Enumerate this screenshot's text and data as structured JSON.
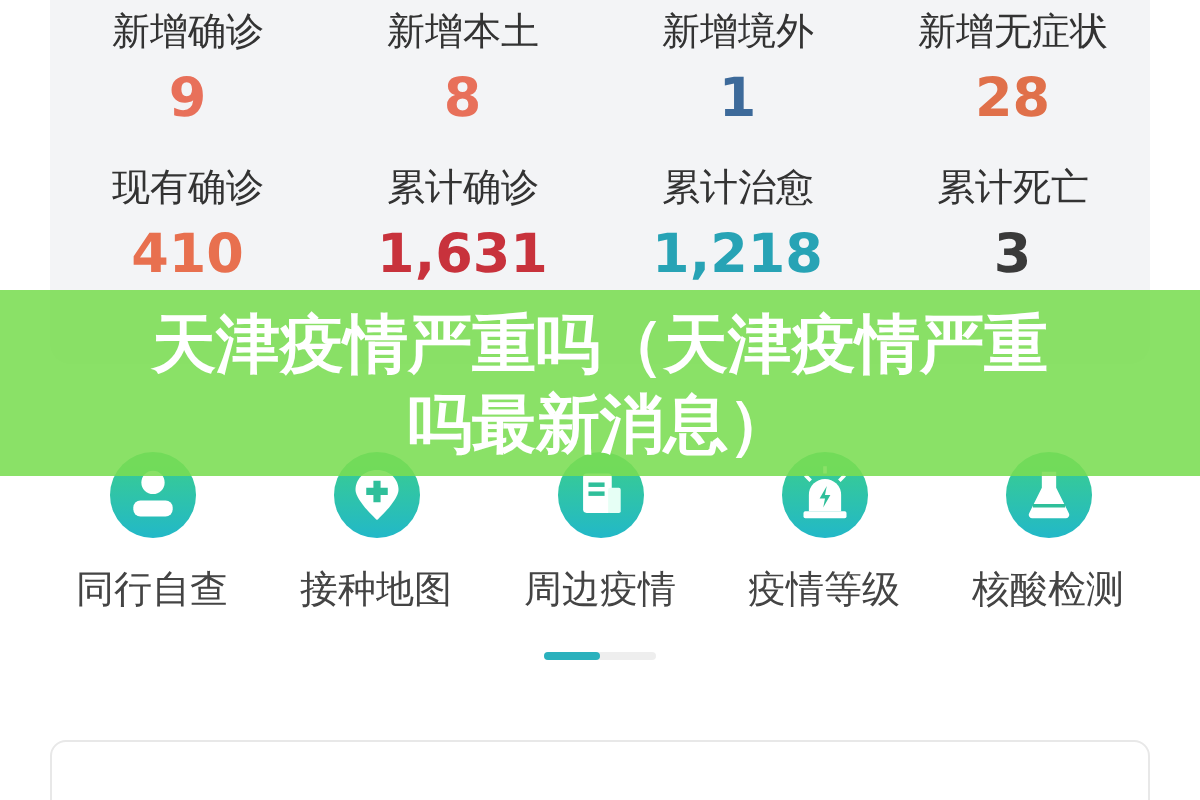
{
  "stats": [
    {
      "label": "新增确诊",
      "value": "9",
      "color": "#e8705a"
    },
    {
      "label": "新增本土",
      "value": "8",
      "color": "#e8705a"
    },
    {
      "label": "新增境外",
      "value": "1",
      "color": "#3d6a9a"
    },
    {
      "label": "新增无症状",
      "value": "28",
      "color": "#e0704a"
    },
    {
      "label": "现有确诊",
      "value": "410",
      "color": "#e8704f"
    },
    {
      "label": "累计确诊",
      "value": "1,631",
      "color": "#c8323c"
    },
    {
      "label": "累计治愈",
      "value": "1,218",
      "color": "#27a3b5"
    },
    {
      "label": "累计死亡",
      "value": "3",
      "color": "#3a3a3a"
    }
  ],
  "shortcuts": [
    {
      "label": "同行自查"
    },
    {
      "label": "接种地图"
    },
    {
      "label": "周边疫情"
    },
    {
      "label": "疫情等级"
    },
    {
      "label": "核酸检测"
    }
  ],
  "banner": {
    "title": "天津疫情严重吗（天津疫情严重吗最新消息）"
  }
}
